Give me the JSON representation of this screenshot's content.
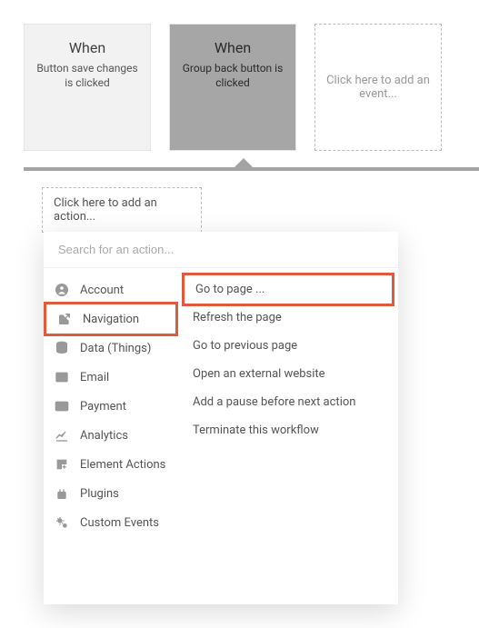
{
  "events": [
    {
      "when": "When",
      "desc": "Button save changes is clicked"
    },
    {
      "when": "When",
      "desc": "Group back button is clicked"
    }
  ],
  "add_event_label": "Click here to add an event...",
  "add_action_label": "Click here to add an action...",
  "search_placeholder": "Search for an action...",
  "categories": [
    {
      "label": "Account"
    },
    {
      "label": "Navigation"
    },
    {
      "label": "Data (Things)"
    },
    {
      "label": "Email"
    },
    {
      "label": "Payment"
    },
    {
      "label": "Analytics"
    },
    {
      "label": "Element Actions"
    },
    {
      "label": "Plugins"
    },
    {
      "label": "Custom Events"
    }
  ],
  "actions": [
    {
      "label": "Go to page ..."
    },
    {
      "label": "Refresh the page"
    },
    {
      "label": "Go to previous page"
    },
    {
      "label": "Open an external website"
    },
    {
      "label": "Add a pause before next action"
    },
    {
      "label": "Terminate this workflow"
    }
  ]
}
